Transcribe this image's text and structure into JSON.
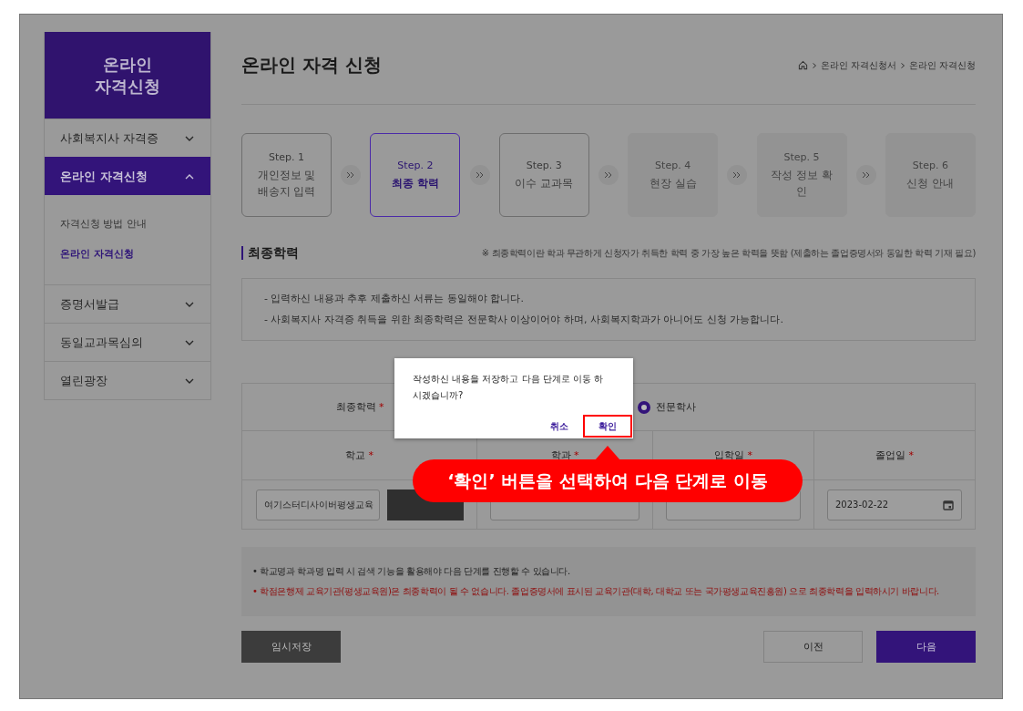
{
  "logo": {
    "lines": [
      "온라인",
      "자격신청"
    ]
  },
  "sidebar": {
    "items": [
      {
        "label": "사회복지사 자격증",
        "expanded": false
      },
      {
        "label": "온라인 자격신청",
        "expanded": true,
        "children": [
          {
            "label": "자격신청 방법 안내",
            "selected": false
          },
          {
            "label": "온라인 자격신청",
            "selected": true
          }
        ]
      },
      {
        "label": "증명서발급",
        "expanded": false
      },
      {
        "label": "동일교과목심의",
        "expanded": false
      },
      {
        "label": "열린광장",
        "expanded": false
      }
    ]
  },
  "page_title": "온라인 자격 신청",
  "breadcrumb": [
    "온라인 자격신청서",
    "온라인 자격신청"
  ],
  "steps": [
    {
      "step": "Step. 1",
      "label": "개인정보 및 배송지 입력",
      "selected": false,
      "disabled": false
    },
    {
      "step": "Step. 2",
      "label": "최종 학력",
      "selected": true,
      "disabled": false
    },
    {
      "step": "Step. 3",
      "label": "이수 교과목",
      "selected": false,
      "disabled": false
    },
    {
      "step": "Step. 4",
      "label": "현장 실습",
      "selected": false,
      "disabled": true
    },
    {
      "step": "Step. 5",
      "label": "작성 정보 확인",
      "selected": false,
      "disabled": true
    },
    {
      "step": "Step. 6",
      "label": "신청 안내",
      "selected": false,
      "disabled": true
    }
  ],
  "section": {
    "title": "최종학력",
    "note": "※ 최종학력이란 학과 무관하게 신청자가 취득한 학력 중 가장 높은 학력을 뜻함 (제출하는 졸업증명서와 동일한 학력 기재 필요)"
  },
  "info": [
    "-  입력하신 내용과 추후 제출하신 서류는 동일해야 합니다.",
    "-  사회복지사 자격증 취득을 위한 최종학력은 전문학사 이상이어야 하며, 사회복지학과가 아니어도 신청 가능합니다."
  ],
  "form": {
    "education_label": "최종학력",
    "required_mark": "*",
    "education_options": [
      {
        "label": "전문학사",
        "selected": true
      }
    ],
    "columns": [
      "학교",
      "학과",
      "입학일",
      "졸업일"
    ],
    "school_value": "여기스터디사이버평생교육",
    "graduation_date": "2023-02-22"
  },
  "notes": [
    {
      "text": "• 학교명과 학과명 입력 시 검색 기능을 활용해야 다음 단계를 진행할 수 있습니다.",
      "kind": "normal"
    },
    {
      "text": "• 학점은행제 교육기관(평생교육원)은 최종학력이 될 수 없습니다. 졸업증명서에 표시된 교육기관(대학, 대학교 또는 국가평생교육진흥원) 으로 최종학력을 입력하시기 바랍니다.",
      "kind": "warning"
    }
  ],
  "buttons": {
    "save": "임시저장",
    "prev": "이전",
    "next": "다음"
  },
  "dialog": {
    "message": "작성하신 내용을 저장하고 다음 단계로 이동 하시겠습니까?",
    "cancel": "취소",
    "confirm": "확인"
  },
  "callout": "‘확인’ 버튼을 선택하여 다음 단계로 이동"
}
